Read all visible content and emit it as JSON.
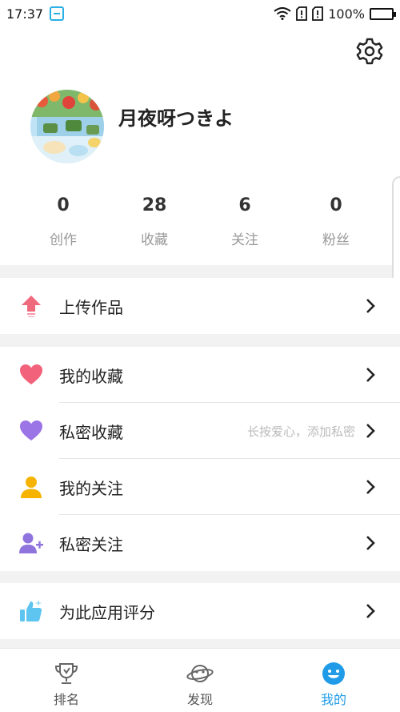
{
  "status_bar": {
    "time": "17:37",
    "battery": "100%",
    "battery_level": 1.0
  },
  "profile": {
    "username": "月夜呀つきよ",
    "stats": [
      {
        "value": "0",
        "label": "创作"
      },
      {
        "value": "28",
        "label": "收藏"
      },
      {
        "value": "6",
        "label": "关注"
      },
      {
        "value": "0",
        "label": "粉丝"
      }
    ]
  },
  "menu": {
    "upload": {
      "label": "上传作品",
      "icon": "upload-arrow-icon"
    },
    "group2": [
      {
        "label": "我的收藏",
        "hint": "",
        "icon": "heart-icon"
      },
      {
        "label": "私密收藏",
        "hint": "长按爱心，添加私密",
        "icon": "purple-heart-icon"
      },
      {
        "label": "我的关注",
        "hint": "",
        "icon": "person-icon"
      },
      {
        "label": "私密关注",
        "hint": "",
        "icon": "person-add-icon"
      }
    ],
    "rate": {
      "label": "为此应用评分",
      "icon": "thumbs-up-icon"
    }
  },
  "tabs": [
    {
      "label": "排名",
      "icon": "trophy-icon",
      "active": false
    },
    {
      "label": "发现",
      "icon": "planet-icon",
      "active": false
    },
    {
      "label": "我的",
      "icon": "smiley-icon",
      "active": true
    }
  ],
  "colors": {
    "accent": "#1f9be8",
    "upload": "#f06a7e",
    "heart": "#f2627a",
    "private_heart": "#9b74e6",
    "person": "#f6b400",
    "person_add": "#8f74de",
    "thumb": "#5ec4f0",
    "battery": "#2fb34a"
  }
}
